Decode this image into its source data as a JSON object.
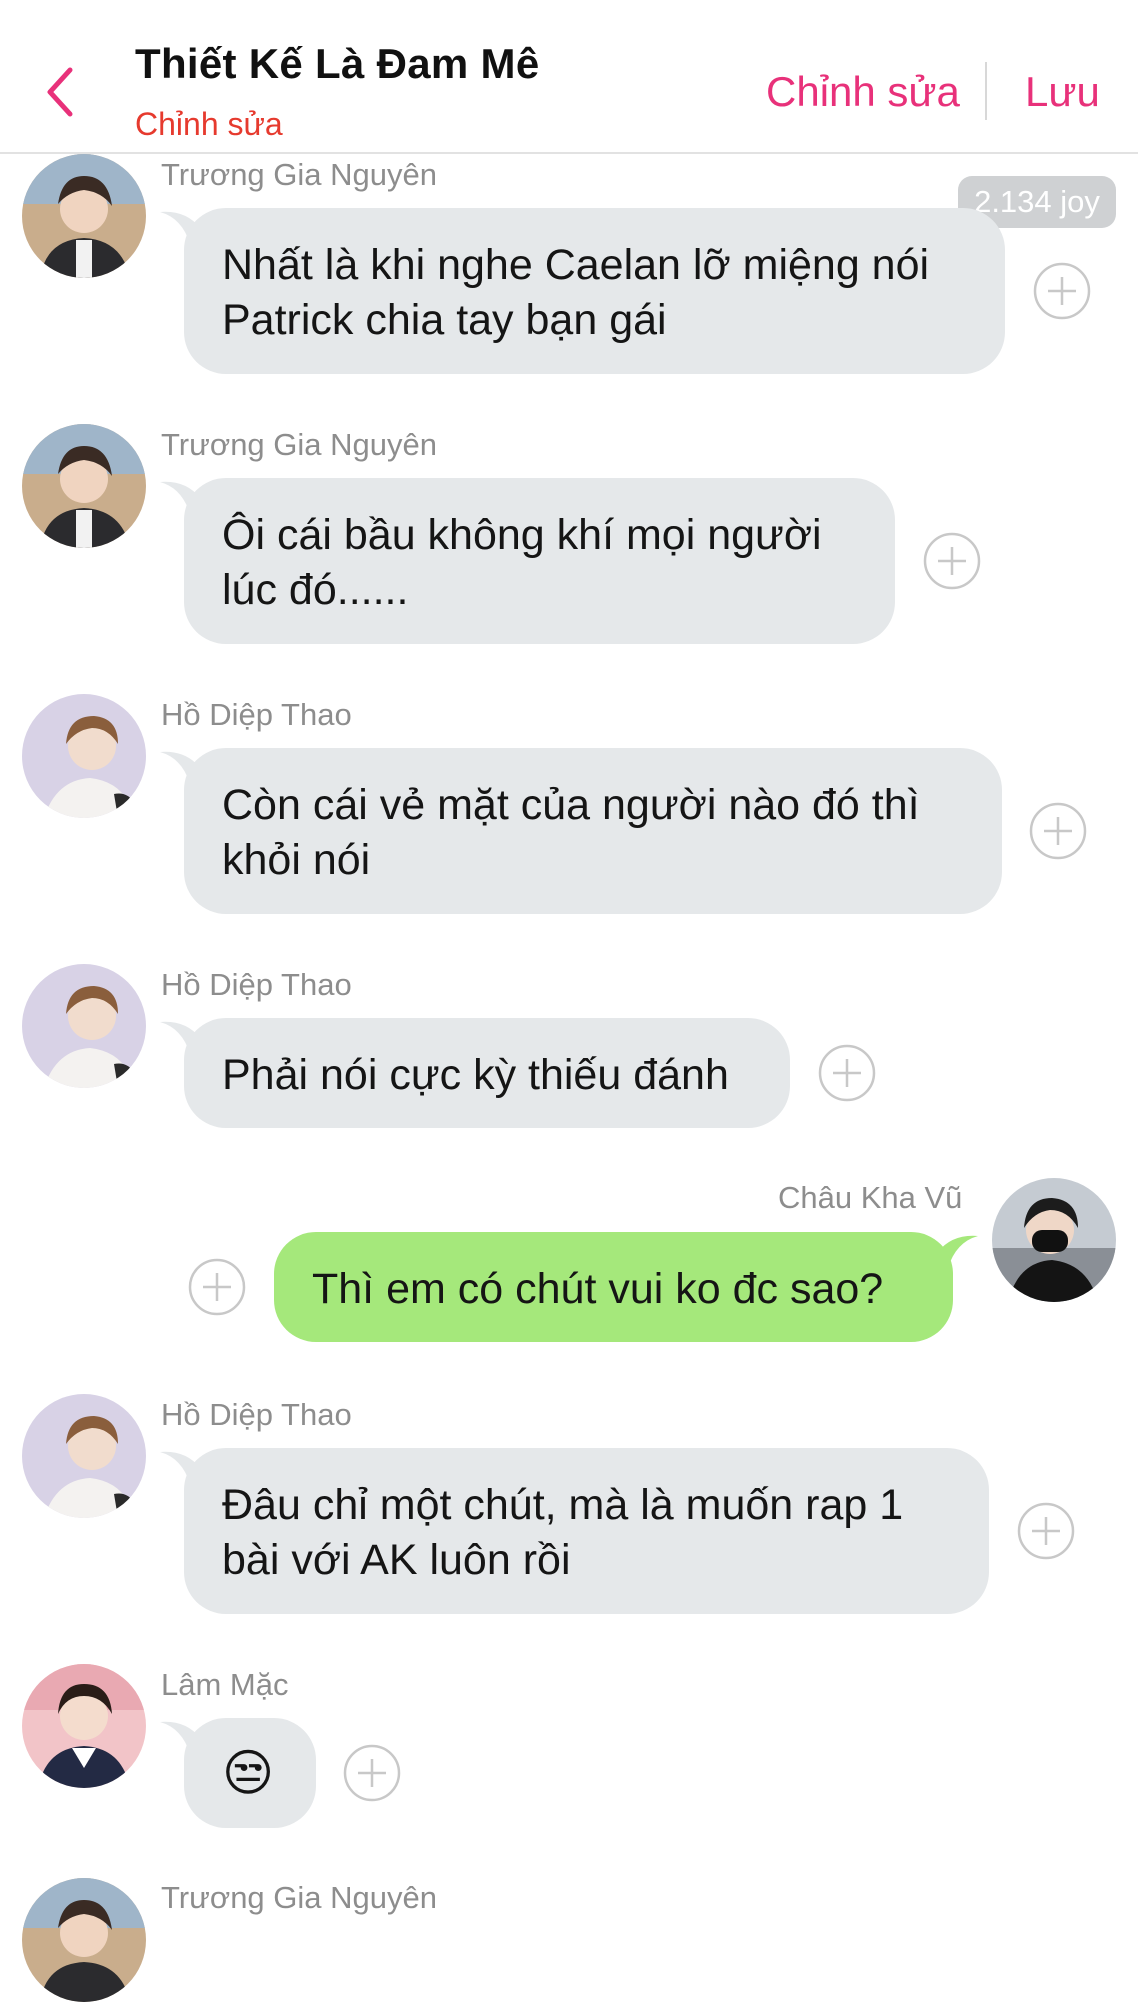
{
  "header": {
    "title": "Thiết Kế Là Đam Mê",
    "subtitle": "Chỉnh sửa",
    "edit_label": "Chỉnh sửa",
    "save_label": "Lưu",
    "accent_color": "#e8317a",
    "subtitle_color": "#e63a2e"
  },
  "badge": {
    "joy": "2.134 joy"
  },
  "messages": [
    {
      "sender": "Trương Gia Nguyên",
      "line1": "Nhất là khi nghe Caelan lỡ miệng nói",
      "line2": "Patrick chia tay bạn gái",
      "side": "incoming"
    },
    {
      "sender": "Trương Gia Nguyên",
      "line1": "Ôi cái bầu không khí mọi người",
      "line2": "lúc đó......",
      "side": "incoming"
    },
    {
      "sender": "Hồ Diệp Thao",
      "line1": "Còn cái vẻ mặt của người nào đó thì",
      "line2": "khỏi nói",
      "side": "incoming"
    },
    {
      "sender": "Hồ Diệp Thao",
      "line1": "Phải nói cực kỳ thiếu đánh",
      "side": "incoming"
    },
    {
      "sender": "Châu Kha Vũ",
      "line1": "Thì em có chút vui ko đc sao?",
      "side": "outgoing"
    },
    {
      "sender": "Hồ Diệp Thao",
      "line1": "Đâu chỉ một chút, mà là muốn rap 1",
      "line2": "bài với AK luôn rồi",
      "side": "incoming"
    },
    {
      "sender": "Lâm Mặc",
      "line1": "😒",
      "side": "incoming"
    },
    {
      "sender": "Trương Gia Nguyên",
      "side": "incoming"
    }
  ],
  "colors": {
    "incoming_bubble": "#e5e8ea",
    "outgoing_bubble": "#a5e87b",
    "name_text": "#8d8d8d"
  }
}
